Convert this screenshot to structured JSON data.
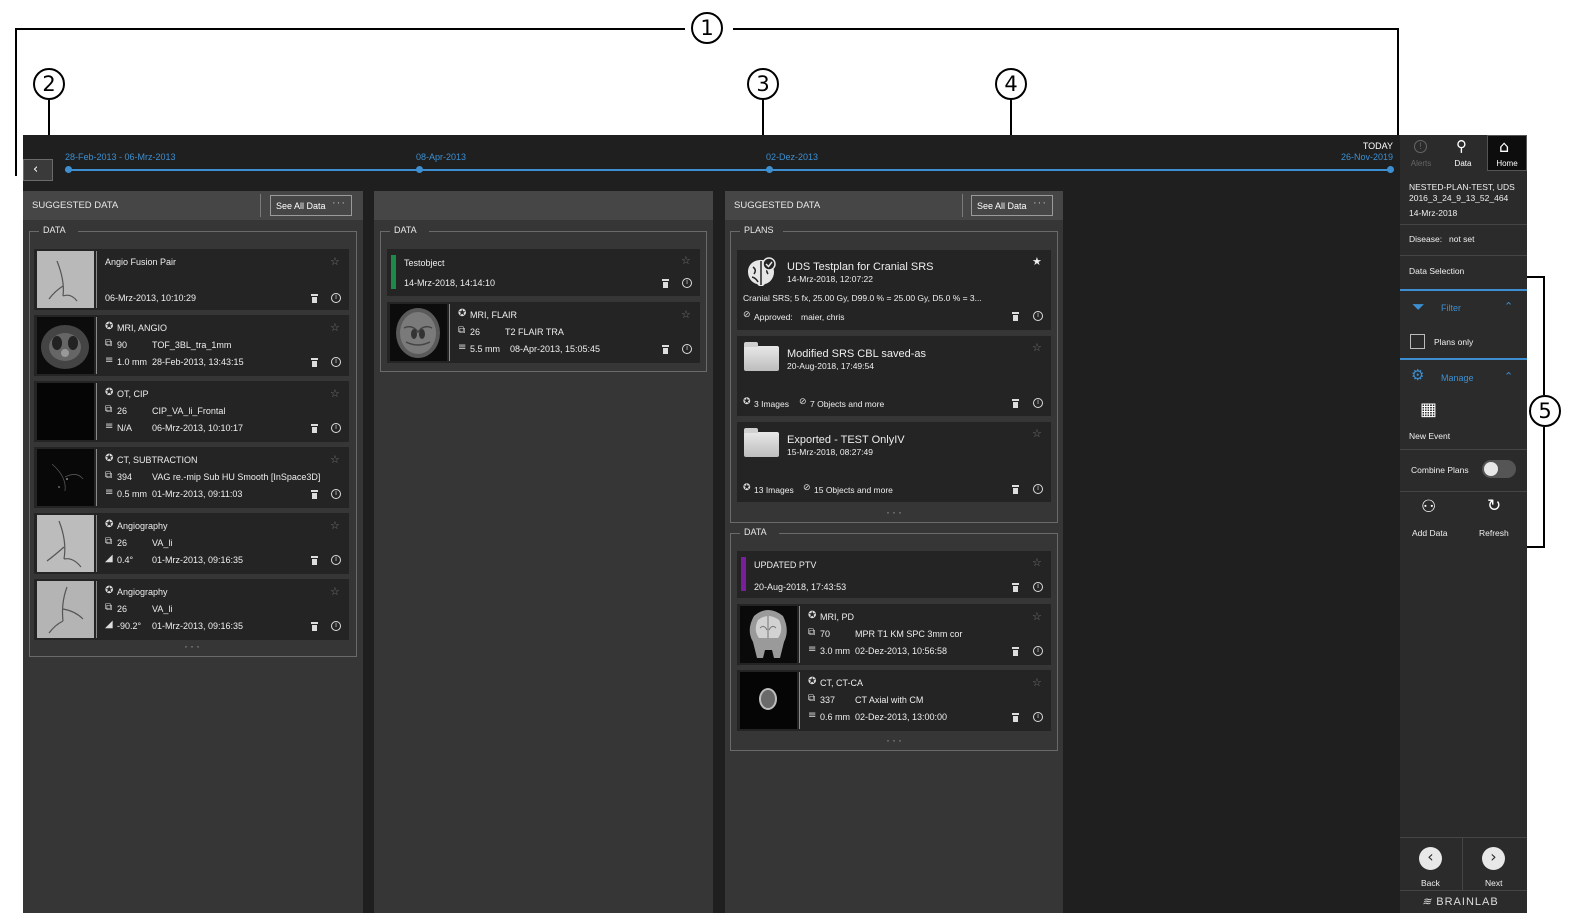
{
  "callouts": [
    "1",
    "2",
    "3",
    "4",
    "5"
  ],
  "timeline": {
    "dates": [
      "28-Feb-2013 - 06-Mrz-2013",
      "08-Apr-2013",
      "02-Dez-2013",
      "26-Nov-2019"
    ],
    "today": "TODAY"
  },
  "col1": {
    "header": "SUGGESTED DATA",
    "see_all": "See All Data",
    "group": "DATA",
    "cards": [
      {
        "title": "Angio Fusion Pair",
        "date": "06-Mrz-2013, 10:10:29"
      },
      {
        "mod": "MRI, ANGIO",
        "count": "90",
        "name": "TOF_3BL_tra_1mm",
        "meta": "1.0 mm",
        "date": "28-Feb-2013, 13:43:15"
      },
      {
        "mod": "OT, CIP",
        "count": "26",
        "name": "CIP_VA_li_Frontal",
        "meta": "N/A",
        "date": "06-Mrz-2013, 10:10:17"
      },
      {
        "mod": "CT, SUBTRACTION",
        "count": "394",
        "name": "VAG re.-mip Sub HU Smooth [InSpace3D]",
        "meta": "0.5 mm",
        "date": "01-Mrz-2013, 09:11:03"
      },
      {
        "mod": "Angiography",
        "count": "26",
        "name": "VA_li",
        "meta": "0.4°",
        "date": "01-Mrz-2013, 09:16:35"
      },
      {
        "mod": "Angiography",
        "count": "26",
        "name": "VA_li",
        "meta": "-90.2°",
        "date": "01-Mrz-2013, 09:16:35"
      }
    ]
  },
  "col2": {
    "group": "DATA",
    "cards": [
      {
        "title": "Testobject",
        "date": "14-Mrz-2018, 14:14:10"
      },
      {
        "mod": "MRI, FLAIR",
        "count": "26",
        "name": "T2 FLAIR TRA",
        "meta": "5.5 mm",
        "date": "08-Apr-2013, 15:05:45"
      }
    ]
  },
  "col3": {
    "header": "SUGGESTED DATA",
    "see_all": "See All Data",
    "plans_group": "PLANS",
    "plans": [
      {
        "title": "UDS Testplan for Cranial SRS",
        "date": "14-Mrz-2018, 12:07:22",
        "desc": "Cranial SRS; 5 fx, 25.00 Gy, D99.0 % = 25.00 Gy, D5.0 % = 3...",
        "approved": "Approved:",
        "approver": "maier, chris"
      },
      {
        "title": "Modified SRS CBL saved-as",
        "date": "20-Aug-2018, 17:49:54",
        "images": "3 Images",
        "objects": "7 Objects and more"
      },
      {
        "title": "Exported - TEST OnlyIV",
        "date": "15-Mrz-2018, 08:27:49",
        "images": "13 Images",
        "objects": "15 Objects and more"
      }
    ],
    "data_group": "DATA",
    "cards": [
      {
        "title": "UPDATED PTV",
        "date": "20-Aug-2018, 17:43:53"
      },
      {
        "mod": "MRI, PD",
        "count": "70",
        "name": "MPR T1 KM SPC 3mm cor",
        "meta": "3.0 mm",
        "date": "02-Dez-2013, 10:56:58"
      },
      {
        "mod": "CT, CT-CA",
        "count": "337",
        "name": "CT Axial with CM",
        "meta": "0.6 mm",
        "date": "02-Dez-2013, 13:00:00"
      }
    ]
  },
  "sidebar": {
    "alerts": "Alerts",
    "data": "Data",
    "home": "Home",
    "patient_name": "NESTED-PLAN-TEST, UDS",
    "patient_id": "2016_3_24_9_13_52_464",
    "patient_date": "14-Mrz-2018",
    "disease_label": "Disease:",
    "disease_value": "not set",
    "data_selection": "Data Selection",
    "filter": "Filter",
    "plans_only": "Plans only",
    "manage": "Manage",
    "new_event": "New Event",
    "combine_plans": "Combine Plans",
    "add_data": "Add Data",
    "refresh": "Refresh",
    "back": "Back",
    "next": "Next",
    "brand": "BRAINLAB"
  }
}
